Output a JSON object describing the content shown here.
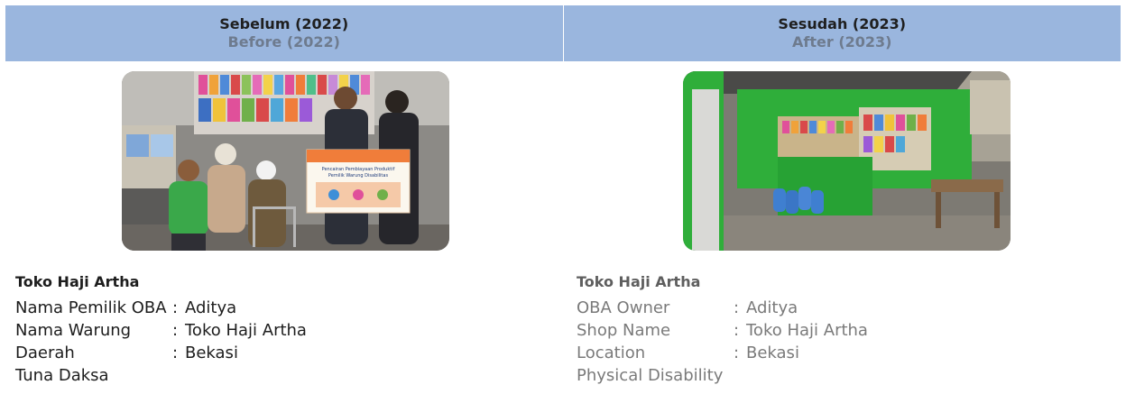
{
  "header": {
    "before_title": "Sebelum (2022)",
    "before_subtitle": "Before (2022)",
    "after_title": "Sesudah (2023)",
    "after_subtitle": "After (2023)"
  },
  "before": {
    "shop_name": "Toko Haji Artha",
    "rows": [
      {
        "label": "Nama Pemilik OBA",
        "colon": ":",
        "value": "Aditya"
      },
      {
        "label": "Nama Warung",
        "colon": ":",
        "value": "Toko Haji Artha"
      },
      {
        "label": "Daerah",
        "colon": ":",
        "value": "Bekasi"
      }
    ],
    "disability": "Tuna Daksa",
    "banner_line1": "Pencairan Pembiayaan Produktif",
    "banner_line2": "Pemilik Warung Disabilitas"
  },
  "after": {
    "shop_name": "Toko Haji Artha",
    "rows": [
      {
        "label": "OBA Owner",
        "colon": ":",
        "value": "Aditya"
      },
      {
        "label": "Shop Name",
        "colon": ":",
        "value": "Toko Haji Artha"
      },
      {
        "label": "Location",
        "colon": ":",
        "value": "Bekasi"
      }
    ],
    "disability": "Physical Disability"
  },
  "colors": {
    "header_bg": "#9ab6de",
    "kiosk_green": "#2fae3a"
  }
}
